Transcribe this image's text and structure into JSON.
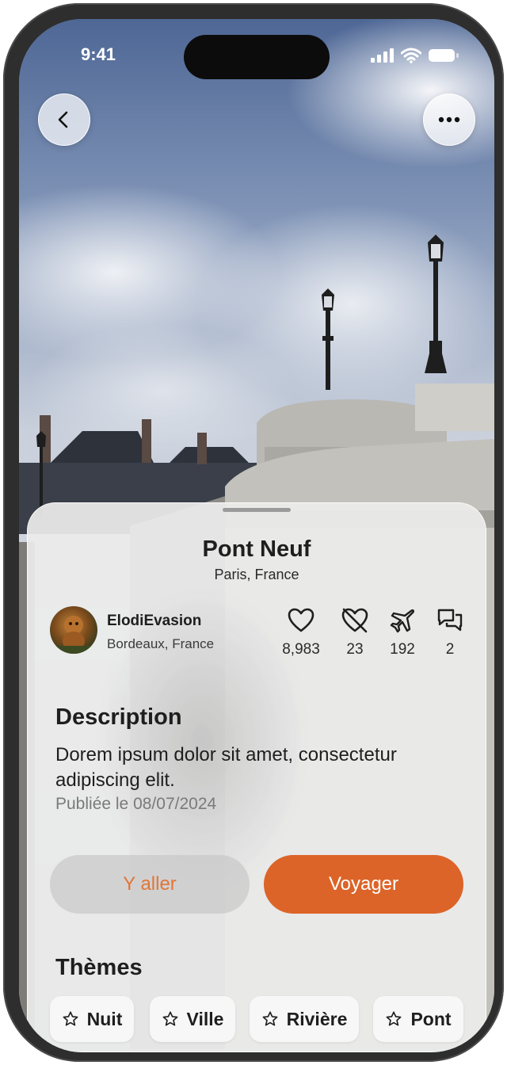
{
  "status_bar": {
    "time": "9:41"
  },
  "header": {
    "back_icon": "chevron-left-icon",
    "more_icon": "ellipsis-icon"
  },
  "place": {
    "title": "Pont Neuf",
    "location": "Paris, France"
  },
  "author": {
    "name": "ElodiEvasion",
    "location": "Bordeaux, France"
  },
  "stats": [
    {
      "icon": "heart-icon",
      "value": "8,983"
    },
    {
      "icon": "heart-off-icon",
      "value": "23"
    },
    {
      "icon": "plane-icon",
      "value": "192"
    },
    {
      "icon": "comments-icon",
      "value": "2"
    }
  ],
  "description": {
    "heading": "Description",
    "text": "Dorem ipsum dolor sit amet, consectetur adipiscing elit.",
    "published": "Publiée le 08/07/2024"
  },
  "actions": {
    "go_label": "Y aller",
    "travel_label": "Voyager"
  },
  "themes": {
    "heading": "Thèmes",
    "chips": [
      {
        "icon": "star-icon",
        "label": "Nuit"
      },
      {
        "icon": "star-icon",
        "label": "Ville"
      },
      {
        "icon": "star-icon",
        "label": "Rivière"
      },
      {
        "icon": "star-icon",
        "label": "Pont"
      }
    ]
  },
  "colors": {
    "accent": "#dc6428",
    "accent_text": "#e07538",
    "sheet": "#ececec"
  }
}
